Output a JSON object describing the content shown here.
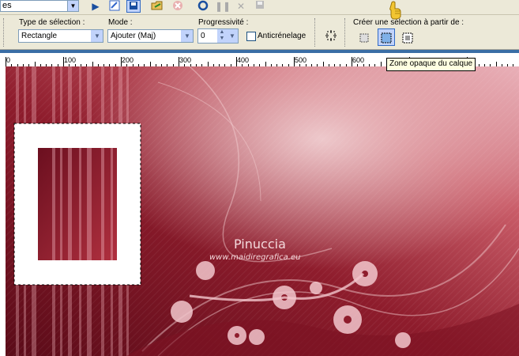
{
  "toolbar": {
    "preset_combo": "es",
    "buttons": [
      "play-icon",
      "script-edit-icon",
      "save-script-icon",
      "open-folder-icon",
      "cancel-icon",
      "record-icon",
      "pause-icon",
      "stop-icon",
      "save-icon"
    ]
  },
  "tool_options": {
    "selection_type": {
      "label": "Type de sélection :",
      "value": "Rectangle"
    },
    "mode": {
      "label": "Mode :",
      "value": "Ajouter (Maj)"
    },
    "feather": {
      "label": "Progressivité :",
      "value": "0"
    },
    "antialias": {
      "label": "Anticrénelage",
      "checked": false
    },
    "create_from": {
      "label": "Créer une sélection à partir de :"
    }
  },
  "ruler": {
    "labels": [
      "0",
      "100",
      "200",
      "300",
      "400",
      "500",
      "600"
    ]
  },
  "tooltip": "Zone opaque du calque",
  "canvas": {
    "watermark_name": "Pinuccia",
    "watermark_site": "www.maidiregrafica.eu"
  },
  "colors": {
    "accent": "#3a6ea5",
    "canvas_dark": "#6d1020",
    "canvas_light": "#d98a93"
  }
}
